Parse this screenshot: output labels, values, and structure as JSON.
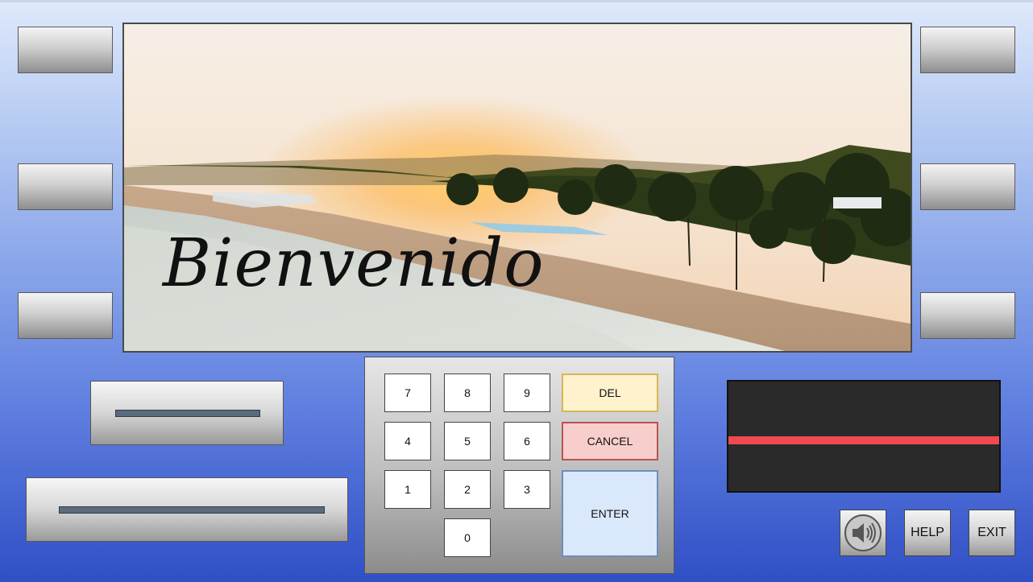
{
  "screen": {
    "welcome_text": "Bienvenido"
  },
  "keypad": {
    "keys": [
      "7",
      "8",
      "9",
      "4",
      "5",
      "6",
      "1",
      "2",
      "3",
      "0"
    ],
    "del_label": "DEL",
    "cancel_label": "CANCEL",
    "enter_label": "ENTER"
  },
  "utility": {
    "speaker_icon": "speaker-icon",
    "help_label": "HELP",
    "exit_label": "EXIT"
  },
  "colors": {
    "del": "#fff2cc",
    "cancel": "#f8cecc",
    "enter": "#dae8fc",
    "card_stripe": "#f04a50"
  }
}
